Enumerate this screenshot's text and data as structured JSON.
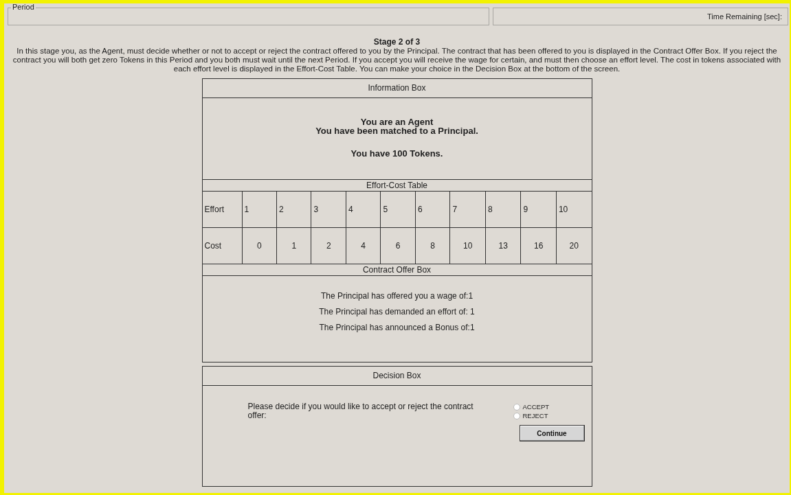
{
  "period_panel": {
    "legend": "Period"
  },
  "time_panel": {
    "label": "Time Remaining [sec]:"
  },
  "stage": {
    "title": "Stage 2 of 3",
    "instructions": "In this stage you, as the Agent, must decide whether or not to accept or reject the contract offered to you by the Principal. The contract that has been offered to you is displayed in the Contract Offer Box. If you reject the contract you will both get zero Tokens in this Period and you both must wait until the next Period. If you accept you will receive the wage for certain, and must then choose an effort level. The cost in tokens associated with each effort level is displayed in the Effort-Cost Table. You can make your choice in the Decision Box at the bottom of the screen."
  },
  "information_box": {
    "title": "Information Box",
    "lines": [
      "You are an Agent",
      "You have been matched to a Principal."
    ],
    "tokens": "You have 100 Tokens."
  },
  "effort_cost_table": {
    "title": "Effort-Cost Table",
    "rows": [
      {
        "header": "Effort",
        "cells": [
          "1",
          "2",
          "3",
          "4",
          "5",
          "6",
          "7",
          "8",
          "9",
          "10"
        ],
        "kind": "index"
      },
      {
        "header": "Cost",
        "cells": [
          "0",
          "1",
          "2",
          "4",
          "6",
          "8",
          "10",
          "13",
          "16",
          "20"
        ],
        "kind": "value"
      }
    ]
  },
  "contract_offer_box": {
    "title": "Contract Offer Box",
    "lines": [
      "The Principal has offered you a wage of:1",
      "The Principal has demanded an effort of: 1",
      "The Principal has announced a Bonus of:1"
    ]
  },
  "decision_box": {
    "title": "Decision Box",
    "prompt": "Please decide if you would like to accept or reject the contract offer:",
    "options": [
      {
        "label": "ACCEPT",
        "selected": false
      },
      {
        "label": "REJECT",
        "selected": false
      }
    ],
    "button": "Continue"
  }
}
